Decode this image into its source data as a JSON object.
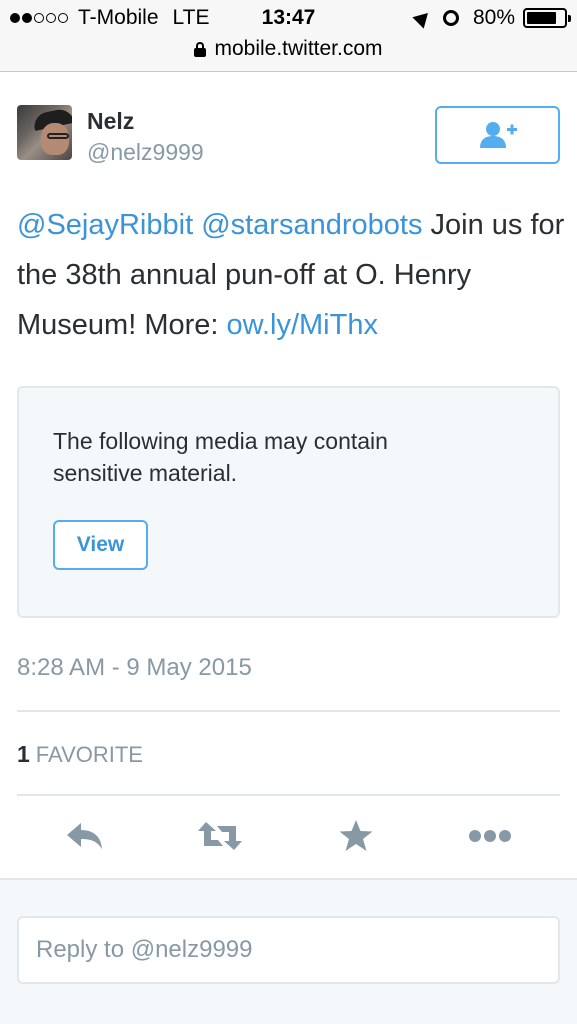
{
  "status_bar": {
    "carrier": "T-Mobile",
    "network": "LTE",
    "time": "13:47",
    "battery": "80%",
    "battery_level": 0.8,
    "signal_dots": [
      true,
      true,
      false,
      false,
      false
    ]
  },
  "url_bar": {
    "url": "mobile.twitter.com"
  },
  "tweet": {
    "author_name": "Nelz",
    "author_handle": "@nelz9999",
    "text_parts": {
      "mention1": "@SejayRibbit",
      "mention2": "@starsandrobots",
      "body": " Join us for the 38th annual pun-off at O. Henry Museum! More: ",
      "link": "ow.ly/MiThx"
    },
    "media_warning": "The following media may contain sensitive material.",
    "view_label": "View",
    "timestamp": "8:28 AM - 9 May 2015",
    "favorite_count": "1",
    "favorite_label": "FAVORITE"
  },
  "actions": {
    "icons": [
      "reply-icon",
      "retweet-icon",
      "favorite-icon",
      "more-icon"
    ]
  },
  "reply": {
    "placeholder": "Reply to @nelz9999"
  },
  "colors": {
    "accent": "#55acee",
    "link": "#3b94d9",
    "muted": "#8899a6",
    "icon": "#8899a6"
  }
}
